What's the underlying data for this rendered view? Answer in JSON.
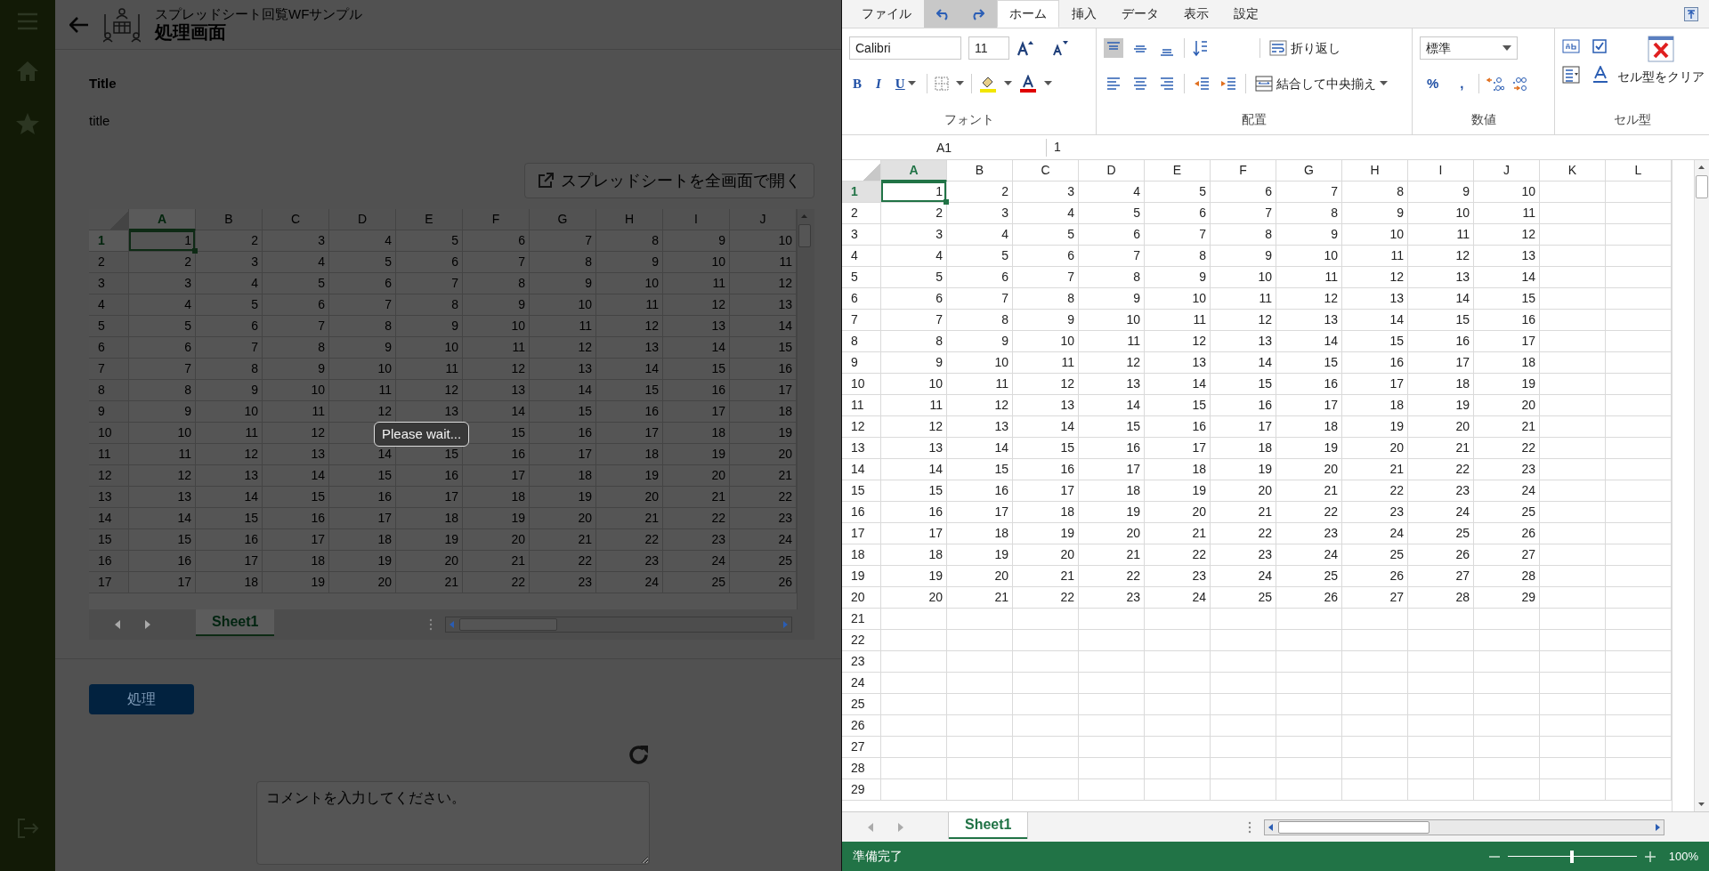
{
  "header": {
    "app_name": "スプレッドシート回覧WFサンプル",
    "title": "処理画面"
  },
  "form": {
    "label": "Title",
    "value": "title",
    "open_button": "スプレッドシートを全画面で開く"
  },
  "embedded_sheet": {
    "columns": [
      {
        "label": "A",
        "selected": true
      },
      {
        "label": "B",
        "selected": false
      },
      {
        "label": "C",
        "selected": false
      },
      {
        "label": "D",
        "selected": false
      },
      {
        "label": "E",
        "selected": false
      },
      {
        "label": "F",
        "selected": false
      },
      {
        "label": "G",
        "selected": false
      },
      {
        "label": "H",
        "selected": false
      },
      {
        "label": "I",
        "selected": false
      },
      {
        "label": "J",
        "selected": false
      }
    ],
    "rows": [
      {
        "header": "1",
        "selected": true,
        "cells": [
          "1",
          "2",
          "3",
          "4",
          "5",
          "6",
          "7",
          "8",
          "9",
          "10"
        ]
      },
      {
        "header": "2",
        "selected": false,
        "cells": [
          "2",
          "3",
          "4",
          "5",
          "6",
          "7",
          "8",
          "9",
          "10",
          "11"
        ]
      },
      {
        "header": "3",
        "selected": false,
        "cells": [
          "3",
          "4",
          "5",
          "6",
          "7",
          "8",
          "9",
          "10",
          "11",
          "12"
        ]
      },
      {
        "header": "4",
        "selected": false,
        "cells": [
          "4",
          "5",
          "6",
          "7",
          "8",
          "9",
          "10",
          "11",
          "12",
          "13"
        ]
      },
      {
        "header": "5",
        "selected": false,
        "cells": [
          "5",
          "6",
          "7",
          "8",
          "9",
          "10",
          "11",
          "12",
          "13",
          "14"
        ]
      },
      {
        "header": "6",
        "selected": false,
        "cells": [
          "6",
          "7",
          "8",
          "9",
          "10",
          "11",
          "12",
          "13",
          "14",
          "15"
        ]
      },
      {
        "header": "7",
        "selected": false,
        "cells": [
          "7",
          "8",
          "9",
          "10",
          "11",
          "12",
          "13",
          "14",
          "15",
          "16"
        ]
      },
      {
        "header": "8",
        "selected": false,
        "cells": [
          "8",
          "9",
          "10",
          "11",
          "12",
          "13",
          "14",
          "15",
          "16",
          "17"
        ]
      },
      {
        "header": "9",
        "selected": false,
        "cells": [
          "9",
          "10",
          "11",
          "12",
          "13",
          "14",
          "15",
          "16",
          "17",
          "18"
        ]
      },
      {
        "header": "10",
        "selected": false,
        "cells": [
          "10",
          "11",
          "12",
          null,
          null,
          "15",
          "16",
          "17",
          "18",
          "19"
        ]
      },
      {
        "header": "11",
        "selected": false,
        "cells": [
          "11",
          "12",
          "13",
          "14",
          "15",
          "16",
          "17",
          "18",
          "19",
          "20"
        ]
      },
      {
        "header": "12",
        "selected": false,
        "cells": [
          "12",
          "13",
          "14",
          "15",
          "16",
          "17",
          "18",
          "19",
          "20",
          "21"
        ]
      },
      {
        "header": "13",
        "selected": false,
        "cells": [
          "13",
          "14",
          "15",
          "16",
          "17",
          "18",
          "19",
          "20",
          "21",
          "22"
        ]
      },
      {
        "header": "14",
        "selected": false,
        "cells": [
          "14",
          "15",
          "16",
          "17",
          "18",
          "19",
          "20",
          "21",
          "22",
          "23"
        ]
      },
      {
        "header": "15",
        "selected": false,
        "cells": [
          "15",
          "16",
          "17",
          "18",
          "19",
          "20",
          "21",
          "22",
          "23",
          "24"
        ]
      },
      {
        "header": "16",
        "selected": false,
        "cells": [
          "16",
          "17",
          "18",
          "19",
          "20",
          "21",
          "22",
          "23",
          "24",
          "25"
        ]
      },
      {
        "header": "17",
        "selected": false,
        "cells": [
          "17",
          "18",
          "19",
          "20",
          "21",
          "22",
          "23",
          "24",
          "25",
          "26"
        ]
      }
    ],
    "sheet_tab": "Sheet1"
  },
  "loading_message": "Please wait...",
  "process_button": "処理",
  "comment": {
    "placeholder": "コメントを入力してください。"
  },
  "spreadsheet": {
    "tabs": [
      {
        "label": "ファイル",
        "selected": false
      },
      {
        "label": "ホーム",
        "selected": true
      },
      {
        "label": "挿入",
        "selected": false
      },
      {
        "label": "データ",
        "selected": false
      },
      {
        "label": "表示",
        "selected": false
      },
      {
        "label": "設定",
        "selected": false
      }
    ],
    "ribbon": {
      "font_name": "Calibri",
      "font_size": "11",
      "style_buttons": [
        "B",
        "I",
        "U"
      ],
      "vertical_align": [
        {
          "selected": true
        },
        {
          "selected": false
        },
        {
          "selected": false
        }
      ],
      "wrap_button": "折り返し",
      "merge_button": "結合して中央揃え",
      "number_format": "標準",
      "number_buttons": [
        "%",
        ","
      ],
      "clear_button": "セル型をクリア",
      "groups": [
        "フォント",
        "配置",
        "数値",
        "セル型"
      ]
    },
    "name_box": "A1",
    "formula": "1",
    "columns": [
      {
        "label": "A",
        "selected": true
      },
      {
        "label": "B",
        "selected": false
      },
      {
        "label": "C",
        "selected": false
      },
      {
        "label": "D",
        "selected": false
      },
      {
        "label": "E",
        "selected": false
      },
      {
        "label": "F",
        "selected": false
      },
      {
        "label": "G",
        "selected": false
      },
      {
        "label": "H",
        "selected": false
      },
      {
        "label": "I",
        "selected": false
      },
      {
        "label": "J",
        "selected": false
      },
      {
        "label": "K",
        "selected": false
      },
      {
        "label": "L",
        "selected": false
      }
    ],
    "rows": [
      {
        "header": "1",
        "selected": true,
        "cells": [
          "1",
          "2",
          "3",
          "4",
          "5",
          "6",
          "7",
          "8",
          "9",
          "10"
        ]
      },
      {
        "header": "2",
        "selected": false,
        "cells": [
          "2",
          "3",
          "4",
          "5",
          "6",
          "7",
          "8",
          "9",
          "10",
          "11"
        ]
      },
      {
        "header": "3",
        "selected": false,
        "cells": [
          "3",
          "4",
          "5",
          "6",
          "7",
          "8",
          "9",
          "10",
          "11",
          "12"
        ]
      },
      {
        "header": "4",
        "selected": false,
        "cells": [
          "4",
          "5",
          "6",
          "7",
          "8",
          "9",
          "10",
          "11",
          "12",
          "13"
        ]
      },
      {
        "header": "5",
        "selected": false,
        "cells": [
          "5",
          "6",
          "7",
          "8",
          "9",
          "10",
          "11",
          "12",
          "13",
          "14"
        ]
      },
      {
        "header": "6",
        "selected": false,
        "cells": [
          "6",
          "7",
          "8",
          "9",
          "10",
          "11",
          "12",
          "13",
          "14",
          "15"
        ]
      },
      {
        "header": "7",
        "selected": false,
        "cells": [
          "7",
          "8",
          "9",
          "10",
          "11",
          "12",
          "13",
          "14",
          "15",
          "16"
        ]
      },
      {
        "header": "8",
        "selected": false,
        "cells": [
          "8",
          "9",
          "10",
          "11",
          "12",
          "13",
          "14",
          "15",
          "16",
          "17"
        ]
      },
      {
        "header": "9",
        "selected": false,
        "cells": [
          "9",
          "10",
          "11",
          "12",
          "13",
          "14",
          "15",
          "16",
          "17",
          "18"
        ]
      },
      {
        "header": "10",
        "selected": false,
        "cells": [
          "10",
          "11",
          "12",
          "13",
          "14",
          "15",
          "16",
          "17",
          "18",
          "19"
        ]
      },
      {
        "header": "11",
        "selected": false,
        "cells": [
          "11",
          "12",
          "13",
          "14",
          "15",
          "16",
          "17",
          "18",
          "19",
          "20"
        ]
      },
      {
        "header": "12",
        "selected": false,
        "cells": [
          "12",
          "13",
          "14",
          "15",
          "16",
          "17",
          "18",
          "19",
          "20",
          "21"
        ]
      },
      {
        "header": "13",
        "selected": false,
        "cells": [
          "13",
          "14",
          "15",
          "16",
          "17",
          "18",
          "19",
          "20",
          "21",
          "22"
        ]
      },
      {
        "header": "14",
        "selected": false,
        "cells": [
          "14",
          "15",
          "16",
          "17",
          "18",
          "19",
          "20",
          "21",
          "22",
          "23"
        ]
      },
      {
        "header": "15",
        "selected": false,
        "cells": [
          "15",
          "16",
          "17",
          "18",
          "19",
          "20",
          "21",
          "22",
          "23",
          "24"
        ]
      },
      {
        "header": "16",
        "selected": false,
        "cells": [
          "16",
          "17",
          "18",
          "19",
          "20",
          "21",
          "22",
          "23",
          "24",
          "25"
        ]
      },
      {
        "header": "17",
        "selected": false,
        "cells": [
          "17",
          "18",
          "19",
          "20",
          "21",
          "22",
          "23",
          "24",
          "25",
          "26"
        ]
      },
      {
        "header": "18",
        "selected": false,
        "cells": [
          "18",
          "19",
          "20",
          "21",
          "22",
          "23",
          "24",
          "25",
          "26",
          "27"
        ]
      },
      {
        "header": "19",
        "selected": false,
        "cells": [
          "19",
          "20",
          "21",
          "22",
          "23",
          "24",
          "25",
          "26",
          "27",
          "28"
        ]
      },
      {
        "header": "20",
        "selected": false,
        "cells": [
          "20",
          "21",
          "22",
          "23",
          "24",
          "25",
          "26",
          "27",
          "28",
          "29"
        ]
      },
      {
        "header": "21",
        "selected": false,
        "cells": []
      },
      {
        "header": "22",
        "selected": false,
        "cells": []
      },
      {
        "header": "23",
        "selected": false,
        "cells": []
      },
      {
        "header": "24",
        "selected": false,
        "cells": []
      },
      {
        "header": "25",
        "selected": false,
        "cells": []
      },
      {
        "header": "26",
        "selected": false,
        "cells": []
      },
      {
        "header": "27",
        "selected": false,
        "cells": []
      },
      {
        "header": "28",
        "selected": false,
        "cells": []
      },
      {
        "header": "29",
        "selected": false,
        "cells": []
      }
    ],
    "sheet_tab": "Sheet1",
    "status": "準備完了",
    "zoom": {
      "level": 0.5,
      "reading": "100%"
    }
  }
}
